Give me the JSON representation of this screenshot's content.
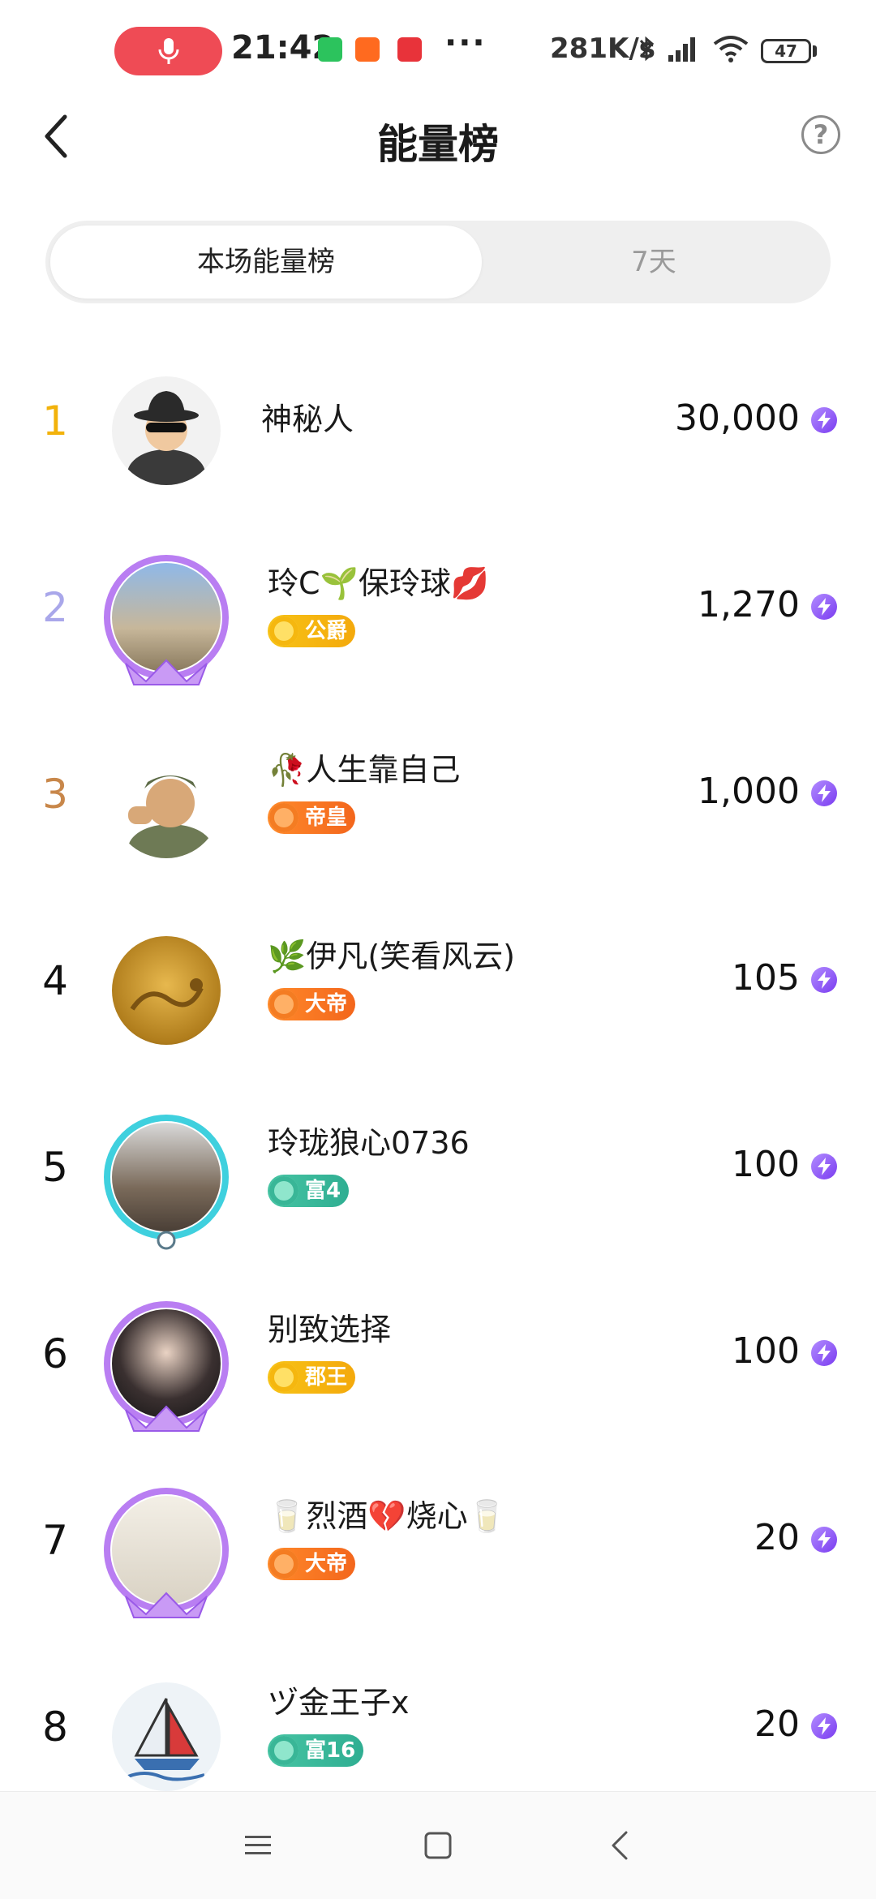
{
  "status_bar": {
    "time": "21:42",
    "more": "···",
    "speed": "281K/s",
    "battery": "47",
    "icons": [
      "mic-icon",
      "bluetooth-icon",
      "signal-icon",
      "wifi-icon",
      "battery-icon"
    ]
  },
  "header": {
    "title": "能量榜",
    "help": "?"
  },
  "tabs": [
    {
      "label": "本场能量榜",
      "active": true
    },
    {
      "label": "7天",
      "active": false
    }
  ],
  "ranking": [
    {
      "rank": "1",
      "name": "神秘人",
      "badge": "",
      "score": "30,000",
      "rank_color": "#f2b20b"
    },
    {
      "rank": "2",
      "name": "玲C🌱保玲球💋",
      "badge": "公爵",
      "badge_style": "gold",
      "score": "1,270",
      "rank_color": "#a9a7ea"
    },
    {
      "rank": "3",
      "name": "🥀人生靠自己",
      "badge": "帝皇",
      "badge_style": "orange",
      "score": "1,000",
      "rank_color": "#c8874a"
    },
    {
      "rank": "4",
      "name": "🌿伊凡(笑看风云)",
      "badge": "大帝",
      "badge_style": "orange",
      "score": "105",
      "rank_color": "#111111"
    },
    {
      "rank": "5",
      "name": "玲珑狼心0736",
      "badge": "富4",
      "badge_style": "teal",
      "score": "100",
      "rank_color": "#111111"
    },
    {
      "rank": "6",
      "name": "别致选择",
      "badge": "郡王",
      "badge_style": "gold",
      "score": "100",
      "rank_color": "#111111"
    },
    {
      "rank": "7",
      "name": "🥛烈酒💔烧心🥛",
      "badge": "大帝",
      "badge_style": "orange",
      "score": "20",
      "rank_color": "#111111"
    },
    {
      "rank": "8",
      "name": "ヅ金王子x",
      "badge": "富16",
      "badge_style": "teal",
      "score": "20",
      "rank_color": "#111111"
    }
  ],
  "nav": [
    "menu-icon",
    "home-icon",
    "back-icon"
  ]
}
